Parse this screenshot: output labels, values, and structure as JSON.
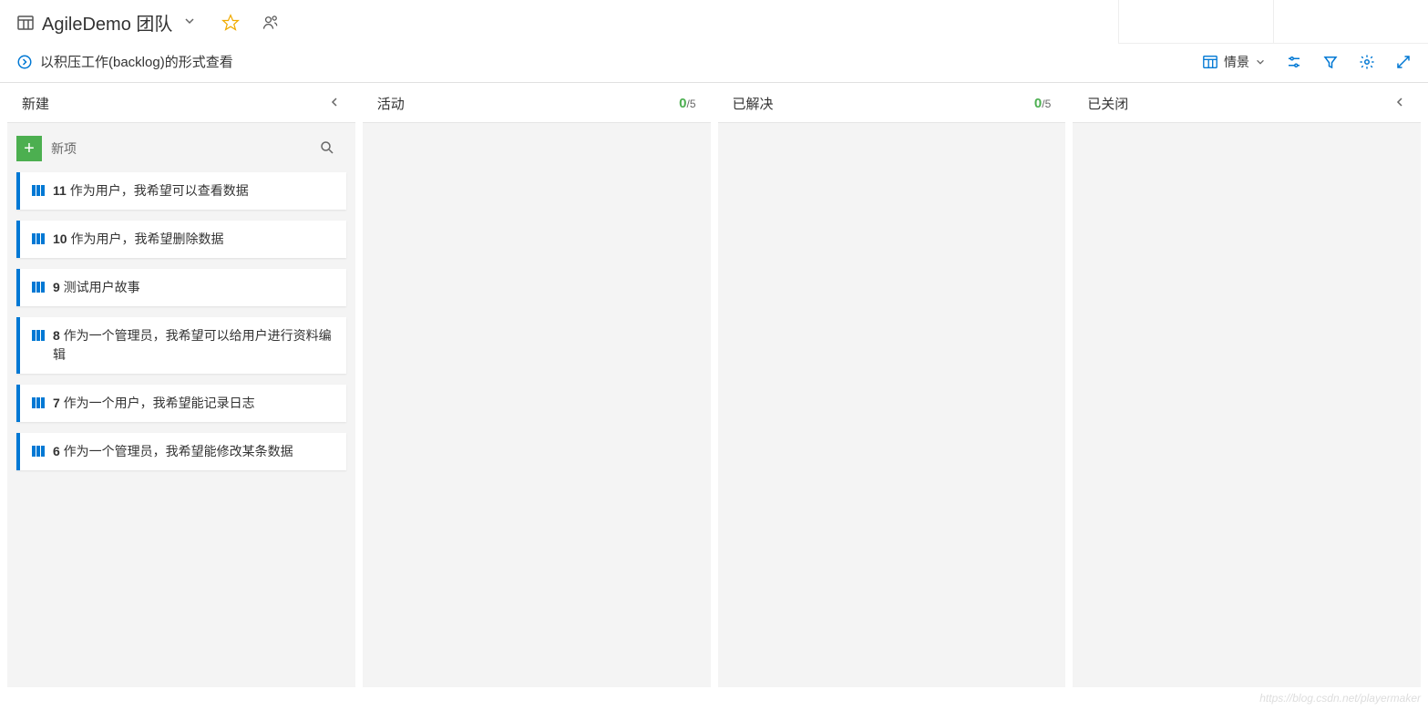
{
  "header": {
    "team_name": "AgileDemo 团队"
  },
  "subheader": {
    "view_link_text": "以积压工作(backlog)的形式查看",
    "scene_label": "情景"
  },
  "columns": [
    {
      "title": "新建",
      "collapsible": true,
      "wip": null,
      "new_item_label": "新项"
    },
    {
      "title": "活动",
      "collapsible": false,
      "wip": {
        "count": 0,
        "limit": 5
      }
    },
    {
      "title": "已解决",
      "collapsible": false,
      "wip": {
        "count": 0,
        "limit": 5
      }
    },
    {
      "title": "已关闭",
      "collapsible": true,
      "wip": null
    }
  ],
  "cards": [
    {
      "id": "11",
      "title": "作为用户，我希望可以查看数据"
    },
    {
      "id": "10",
      "title": "作为用户，我希望删除数据"
    },
    {
      "id": "9",
      "title": "测试用户故事"
    },
    {
      "id": "8",
      "title": "作为一个管理员，我希望可以给用户进行资料编辑"
    },
    {
      "id": "7",
      "title": "作为一个用户，我希望能记录日志"
    },
    {
      "id": "6",
      "title": "作为一个管理员，我希望能修改某条数据"
    }
  ],
  "watermark": "https://blog.csdn.net/playermaker"
}
